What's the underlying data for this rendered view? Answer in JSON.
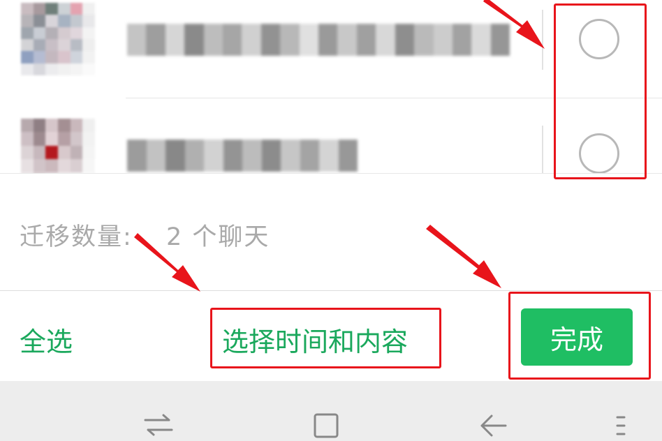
{
  "chat_list": {
    "items": [
      {
        "name": "",
        "selected": false
      },
      {
        "name": "",
        "selected": false
      }
    ]
  },
  "migration": {
    "count_label": "迁移数量:",
    "count_value": "2 个聊天"
  },
  "action_bar": {
    "select_all_label": "全选",
    "select_time_content_label": "选择时间和内容",
    "done_label": "完成"
  },
  "nav_bar": {
    "icons": [
      "switch-apps-icon",
      "home-square-icon",
      "back-arrow-icon",
      "menu-icon"
    ]
  },
  "colors": {
    "accent_green": "#1aa85c",
    "done_button": "#1fbe63",
    "annotation_red": "#e8141b",
    "muted_text": "#a9a9a9",
    "nav_background": "#ededed"
  }
}
